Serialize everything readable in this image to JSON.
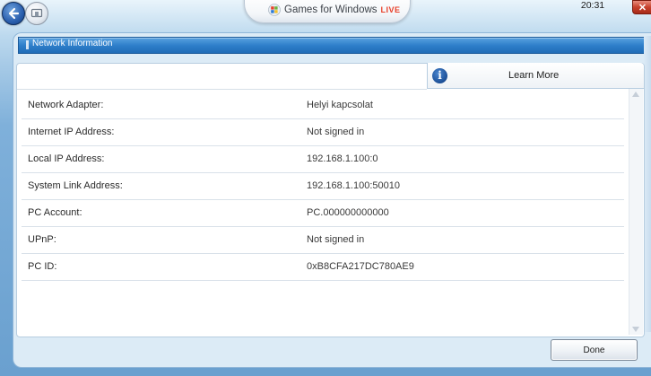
{
  "top_bar": {
    "brand_main": "Games for Windows",
    "brand_live": "LIVE",
    "clock": "20:31",
    "close_glyph": "✕"
  },
  "panel": {
    "title": "Network Information",
    "learn_more": "Learn More",
    "info_glyph": "i",
    "rows": [
      {
        "label": "Network Adapter:",
        "value": "Helyi kapcsolat"
      },
      {
        "label": "Internet IP Address:",
        "value": "Not signed in"
      },
      {
        "label": "Local IP Address:",
        "value": "192.168.1.100:0"
      },
      {
        "label": "System Link Address:",
        "value": "192.168.1.100:50010"
      },
      {
        "label": "PC Account:",
        "value": "PC.000000000000"
      },
      {
        "label": "UPnP:",
        "value": "Not signed in"
      },
      {
        "label": "PC ID:",
        "value": "0xB8CFA217DC780AE9"
      }
    ]
  },
  "footer": {
    "done_label": "Done"
  },
  "icons": {
    "back": "back-arrow-icon",
    "home": "home-icon",
    "logo": "windows-logo-icon",
    "info": "info-icon",
    "close": "close-icon"
  },
  "colors": {
    "title_bar": "#2f7fca",
    "live_accent": "#e8402a",
    "close_button": "#c7412c",
    "background": "#7fb0da"
  }
}
